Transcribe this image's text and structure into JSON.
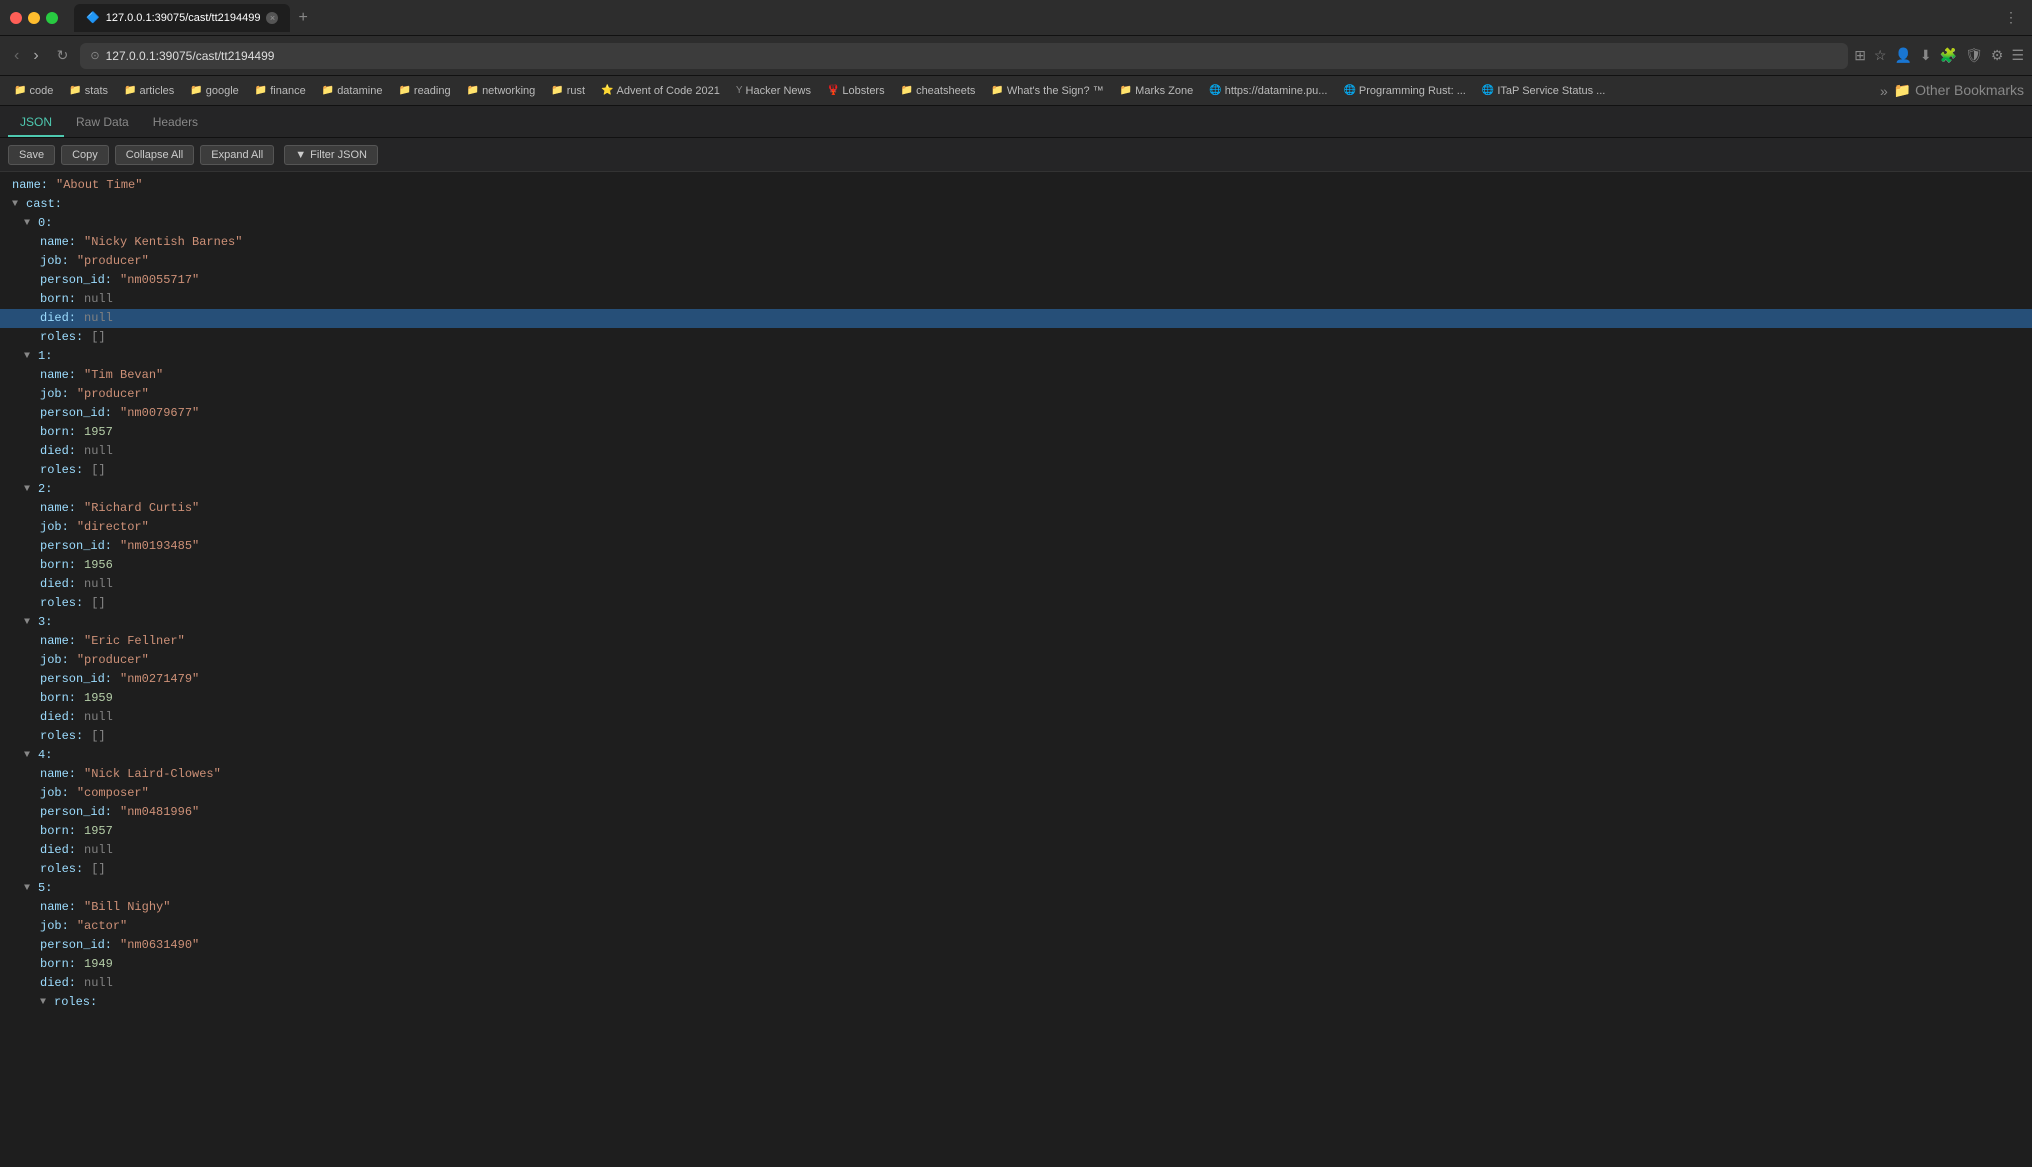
{
  "titlebar": {
    "tab_url": "127.0.0.1:39075/cast/tt2194499",
    "new_tab_label": "+",
    "back_label": "‹",
    "forward_label": "›"
  },
  "navbar": {
    "url": "127.0.0.1:39075/cast/tt2194499",
    "refresh_label": "↻"
  },
  "bookmarks": [
    {
      "icon": "📁",
      "label": "code"
    },
    {
      "icon": "📁",
      "label": "stats"
    },
    {
      "icon": "📁",
      "label": "articles"
    },
    {
      "icon": "📁",
      "label": "google"
    },
    {
      "icon": "📁",
      "label": "finance"
    },
    {
      "icon": "📁",
      "label": "datamine"
    },
    {
      "icon": "📁",
      "label": "reading"
    },
    {
      "icon": "📁",
      "label": "networking"
    },
    {
      "icon": "📁",
      "label": "rust"
    },
    {
      "icon": "⭐",
      "label": "Advent of Code 2021"
    },
    {
      "icon": "Y",
      "label": "Hacker News"
    },
    {
      "icon": "🦞",
      "label": "Lobsters"
    },
    {
      "icon": "📁",
      "label": "cheatsheets"
    },
    {
      "icon": "📁",
      "label": "What's the Sign? ™"
    },
    {
      "icon": "📁",
      "label": "Marks Zone"
    },
    {
      "icon": "🌐",
      "label": "https://datamine.pu..."
    },
    {
      "icon": "🌐",
      "label": "Programming Rust: ..."
    },
    {
      "icon": "🌐",
      "label": "ITaP Service Status ..."
    }
  ],
  "json_tabs": [
    {
      "label": "JSON",
      "active": true
    },
    {
      "label": "Raw Data",
      "active": false
    },
    {
      "label": "Headers",
      "active": false
    }
  ],
  "toolbar": {
    "save_label": "Save",
    "copy_label": "Copy",
    "collapse_all_label": "Collapse All",
    "expand_all_label": "Expand All",
    "filter_label": "Filter JSON"
  },
  "json_data": {
    "root_name_key": "name:",
    "root_name_val": "\"About Time\"",
    "root_cast_key": "cast:",
    "items": [
      {
        "index": "0:",
        "name_key": "name:",
        "name_val": "\"Nicky Kentish Barnes\"",
        "job_key": "job:",
        "job_val": "\"producer\"",
        "person_id_key": "person_id:",
        "person_id_val": "\"nm0055717\"",
        "born_key": "born:",
        "born_val": "null",
        "died_key": "died:",
        "died_val": "null",
        "roles_key": "roles:",
        "roles_val": "[]",
        "died_highlighted": true
      },
      {
        "index": "1:",
        "name_key": "name:",
        "name_val": "\"Tim Bevan\"",
        "job_key": "job:",
        "job_val": "\"producer\"",
        "person_id_key": "person_id:",
        "person_id_val": "\"nm0079677\"",
        "born_key": "born:",
        "born_val": "1957",
        "died_key": "died:",
        "died_val": "null",
        "roles_key": "roles:",
        "roles_val": "[]"
      },
      {
        "index": "2:",
        "name_key": "name:",
        "name_val": "\"Richard Curtis\"",
        "job_key": "job:",
        "job_val": "\"director\"",
        "person_id_key": "person_id:",
        "person_id_val": "\"nm0193485\"",
        "born_key": "born:",
        "born_val": "1956",
        "died_key": "died:",
        "died_val": "null",
        "roles_key": "roles:",
        "roles_val": "[]"
      },
      {
        "index": "3:",
        "name_key": "name:",
        "name_val": "\"Eric Fellner\"",
        "job_key": "job:",
        "job_val": "\"producer\"",
        "person_id_key": "person_id:",
        "person_id_val": "\"nm0271479\"",
        "born_key": "born:",
        "born_val": "1959",
        "died_key": "died:",
        "died_val": "null",
        "roles_key": "roles:",
        "roles_val": "[]"
      },
      {
        "index": "4:",
        "name_key": "name:",
        "name_val": "\"Nick Laird-Clowes\"",
        "job_key": "job:",
        "job_val": "\"composer\"",
        "person_id_key": "person_id:",
        "person_id_val": "\"nm0481996\"",
        "born_key": "born:",
        "born_val": "1957",
        "died_key": "died:",
        "died_val": "null",
        "roles_key": "roles:",
        "roles_val": "[]"
      },
      {
        "index": "5:",
        "name_key": "name:",
        "name_val": "\"Bill Nighy\"",
        "job_key": "job:",
        "job_val": "\"actor\"",
        "person_id_key": "person_id:",
        "person_id_val": "\"nm0631490\"",
        "born_key": "born:",
        "born_val": "1949",
        "died_key": "died:",
        "died_val": "null",
        "roles_key": "roles:",
        "roles_val": null,
        "roles_expanded": true
      }
    ]
  },
  "colors": {
    "highlight_bg": "#264f78",
    "key_color": "#9cdcfe",
    "string_color": "#ce9178",
    "number_color": "#b5cea8",
    "null_color": "#808080"
  }
}
